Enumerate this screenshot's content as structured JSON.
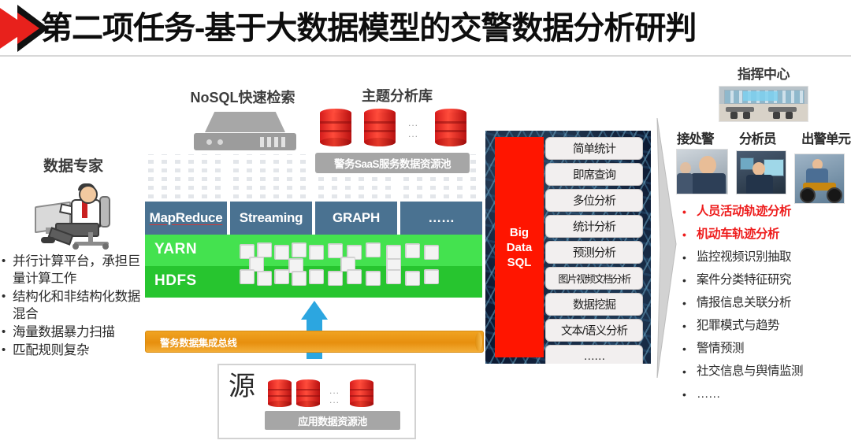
{
  "title": {
    "text": "第二项任务-基于大数据模型的交警数据分析研判",
    "accent_red": "#e8211c",
    "accent_black": "#111111"
  },
  "left_panel": {
    "heading": "数据专家",
    "icon": "data-expert-illustration",
    "bullets": [
      "并行计算平台，承担巨量计算工作",
      "结构化和非结构化数据混合",
      "海量数据暴力扫描",
      "匹配规则复杂"
    ]
  },
  "center": {
    "nosql_caption": "NoSQL快速检索",
    "theme_caption": "主题分析库",
    "saas_platform_label": "警务SaaS服务数据资源池",
    "db_ellipsis": "...",
    "tech_boxes": [
      {
        "label": "MapReduce",
        "underlined": true
      },
      {
        "label": "Streaming",
        "underlined": false
      },
      {
        "label": "GRAPH",
        "underlined": false
      },
      {
        "label": "……",
        "underlined": false
      }
    ],
    "layers": [
      {
        "label": "YARN",
        "color": "#44e24f"
      },
      {
        "label": "HDFS",
        "color": "#27c52f"
      }
    ],
    "bus_label": "警务数据集成总线",
    "bus_color": "#ef9a11",
    "arrow_color": "#2ca6e0",
    "source_box": {
      "label": "源",
      "platform_label": "应用数据资源池",
      "ellipsis": "..."
    }
  },
  "bigdata_panel": {
    "sql_label": "Big Data SQL",
    "sql_lines": [
      "Big",
      "Data",
      "SQL"
    ],
    "sql_color": "#ff1500",
    "background_color": "#0c1a33",
    "capabilities": [
      "简单统计",
      "即席查询",
      "多位分析",
      "统计分析",
      "预测分析",
      "图片视频文档分析",
      "数据挖掘",
      "文本/语义分析",
      "……"
    ]
  },
  "right_panel": {
    "command_center_label": "指挥中心",
    "command_center_photo": "command-center-photo",
    "roles": [
      {
        "label": "接处警",
        "photo": "dispatch-officer-photo"
      },
      {
        "label": "分析员",
        "photo": "analyst-photo"
      },
      {
        "label": "出警单元",
        "photo": "patrol-unit-photo"
      }
    ],
    "highlight_color": "#ee1c1c",
    "bullets": [
      {
        "text": "人员活动轨迹分析",
        "highlighted": true
      },
      {
        "text": "机动车轨迹分析",
        "highlighted": true
      },
      {
        "text": "监控视频识别抽取",
        "highlighted": false
      },
      {
        "text": "案件分类特征研究",
        "highlighted": false
      },
      {
        "text": "情报信息关联分析",
        "highlighted": false
      },
      {
        "text": "犯罪模式与趋势",
        "highlighted": false
      },
      {
        "text": "警情预测",
        "highlighted": false
      },
      {
        "text": "社交信息与舆情监测",
        "highlighted": false
      },
      {
        "text": "……",
        "highlighted": false
      }
    ]
  }
}
